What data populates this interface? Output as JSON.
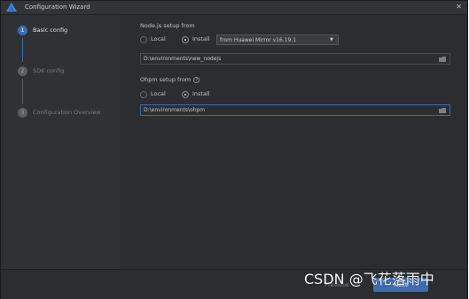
{
  "window": {
    "title": "Configuration Wizard",
    "close_glyph": "✕"
  },
  "steps": [
    {
      "number": "1",
      "label": "Basic config"
    },
    {
      "number": "2",
      "label": "SDK config"
    },
    {
      "number": "3",
      "label": "Configuration Overview"
    }
  ],
  "nodejs": {
    "label": "Node.js setup from",
    "radio_local": "Local",
    "radio_install": "Install",
    "selected": "Install",
    "mirror_value": "from Huawei Mirror v16.19.1",
    "path_value": "D:\\environments\\new_nodejs"
  },
  "ohpm": {
    "label": "Ohpm setup from",
    "help_glyph": "?",
    "radio_local": "Local",
    "radio_install": "Install",
    "selected": "Install",
    "path_value": "D:\\environments\\ohpm"
  },
  "footer": {
    "prev_label": "Previous",
    "next_label": "Next"
  },
  "watermark": "CSDN @飞花落雨中",
  "colors": {
    "accent": "#3b6db3",
    "background": "#2b2d30",
    "sidebar": "#2f3135"
  }
}
